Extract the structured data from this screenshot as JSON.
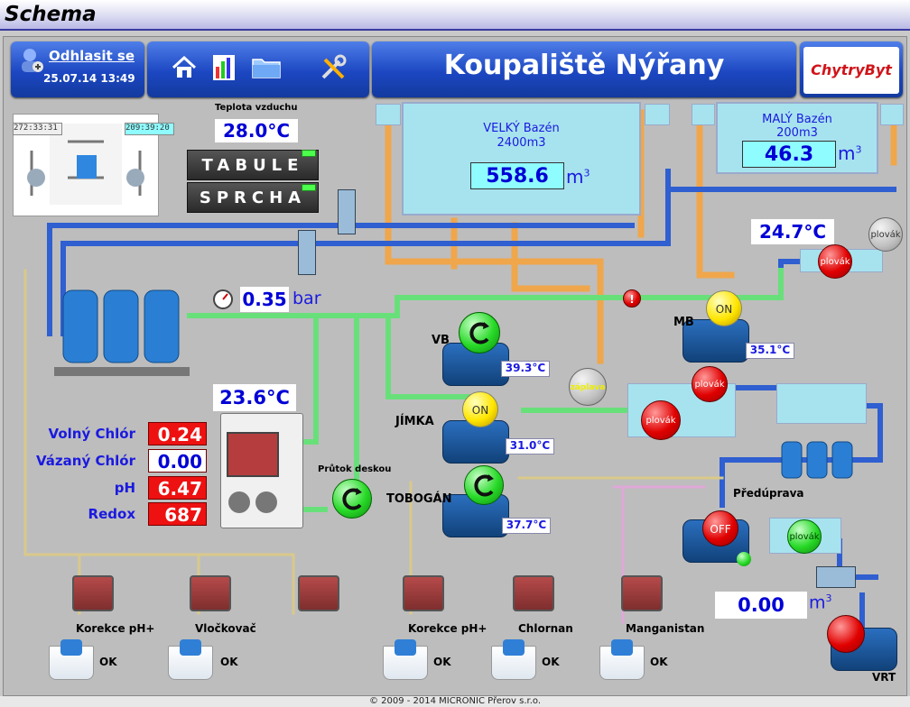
{
  "window": {
    "title": "Schema"
  },
  "header": {
    "logout_label": "Odhlasit se",
    "datetime": "25.07.14 13:49",
    "title": "Koupaliště Nýřany",
    "logo_text": "ChytryByt"
  },
  "toolbar": {
    "icons": [
      "home-icon",
      "chart-icon",
      "folder-icon",
      "tools-icon"
    ]
  },
  "tech_panel": {
    "time_left": "272:33:31",
    "time_right": "209:39:20"
  },
  "air": {
    "label": "Teplota vzduchu",
    "value": "28.0°C"
  },
  "buttons": {
    "tabule": "TABULE",
    "sprcha": "SPRCHA"
  },
  "pools": {
    "big": {
      "name": "VELKÝ Bazén",
      "volume": "2400m3",
      "level": "558.6",
      "unit": "m",
      "sup": "3"
    },
    "small": {
      "name": "MALÝ Bazén",
      "volume": "200m3",
      "level": "46.3",
      "unit": "m",
      "sup": "3"
    }
  },
  "temps": {
    "small_tank": "24.7°C",
    "water": "23.6°C",
    "vb": "39.3°C",
    "jimka": "31.0°C",
    "tobogan": "37.7°C",
    "mb": "35.1°C"
  },
  "pressure": {
    "value": "0.35",
    "unit": "bar"
  },
  "chem": [
    {
      "label": "Volný Chlór",
      "value": "0.24",
      "color": "#ee1111"
    },
    {
      "label": "Vázaný Chlór",
      "value": "0.00",
      "color": "#ffffff"
    },
    {
      "label": "pH",
      "value": "6.47",
      "color": "#ee1111"
    },
    {
      "label": "Redox",
      "value": "687",
      "color": "#ee1111"
    }
  ],
  "pumps": {
    "vb": "VB",
    "jimka": "JÍMKA",
    "tobogan": "TOBOGÁN",
    "mb": "MB",
    "pretreat": "Předúprava",
    "vrt": "VRT",
    "flow": "Průtok deskou"
  },
  "states": {
    "on": "ON",
    "off": "OFF",
    "float": "plovák",
    "flood": "záplava"
  },
  "vrt_volume": {
    "value": "0.00",
    "unit": "m",
    "sup": "3"
  },
  "dosing": [
    {
      "label": "Korekce pH+",
      "status": "OK"
    },
    {
      "label": "Vločkovač",
      "status": "OK"
    },
    {
      "label": "Korekce pH+",
      "status": "OK"
    },
    {
      "label": "Chlornan",
      "status": "OK"
    },
    {
      "label": "Manganistan",
      "status": "OK"
    }
  ],
  "footer": {
    "text": "© 2009 - 2014 MICRONIC Přerov s.r.o."
  },
  "colors": {
    "pipe_blue": "#2f5fd0",
    "pipe_orange": "#f0a64b",
    "pipe_green": "#68e07a",
    "header_blue": "#1c47c2",
    "accent_red": "#ee1111"
  }
}
